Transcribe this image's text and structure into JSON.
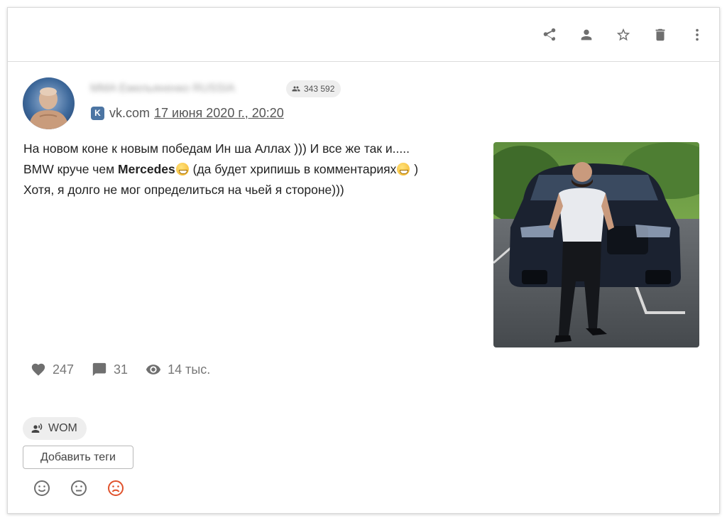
{
  "toolbar": {
    "actions": [
      {
        "name": "share",
        "icon": "share-icon"
      },
      {
        "name": "person",
        "icon": "person-icon"
      },
      {
        "name": "favorite",
        "icon": "star-outline-icon"
      },
      {
        "name": "delete",
        "icon": "trash-icon"
      },
      {
        "name": "more",
        "icon": "more-vertical-icon"
      }
    ]
  },
  "author": {
    "name": "MMA Емельяненко RUSSIA",
    "followers": "343 592",
    "followers_icon": "people-icon"
  },
  "source": {
    "icon": "vk-logo-icon",
    "logo_letter": "K",
    "site": "vk.com",
    "date": "17 июня 2020 г., 20:20"
  },
  "post": {
    "line1": "На новом коне к новым победам Ин ша Аллах ))) И все же так и.....",
    "line2_before": "BMW круче чем ",
    "line2_brand": "Mercedes",
    "line2_middle": " (да будет хрипишь в комментариях",
    "line2_after": " )",
    "line3": "Хотя, я долго не мог определиться на чьей я стороне)))"
  },
  "stats": {
    "likes": "247",
    "comments": "31",
    "views": "14 тыс."
  },
  "tags": {
    "chip_label": "WOM",
    "chip_icon": "voice-icon",
    "add_label": "Добавить теги"
  },
  "sentiment": {
    "options": [
      "positive",
      "neutral",
      "negative"
    ],
    "selected": "negative",
    "colors": {
      "default": "#6f6f6f",
      "negative": "#e0522c"
    }
  },
  "colors": {
    "vk_brand": "#4c75a3",
    "icon_gray": "#6f6f6f",
    "chip_bg": "#eeeeee"
  }
}
